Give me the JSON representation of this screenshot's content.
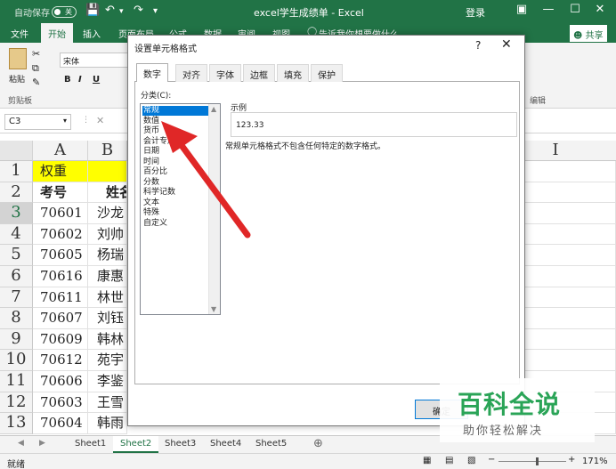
{
  "titlebar": {
    "autosave": "自动保存",
    "autosave_state": "关",
    "doc_title": "excel学生成绩单 - Excel",
    "login": "登录"
  },
  "ribbon_tabs": [
    "文件",
    "开始",
    "插入",
    "页面布局",
    "公式",
    "数据",
    "审阅",
    "视图"
  ],
  "tell_me": "告诉我你想要做什么",
  "share_label": "共享",
  "ribbon": {
    "paste_label": "粘贴",
    "clipboard_label": "剪贴板",
    "font_name": "宋体",
    "bold": "B",
    "italic": "I",
    "underline": "U",
    "edit_label": "编辑"
  },
  "formula": {
    "name_box": "C3",
    "cancel": "✕"
  },
  "sheet": {
    "columns": [
      "A",
      "B",
      "I"
    ],
    "rows": [
      "1",
      "2",
      "3",
      "4",
      "5",
      "6",
      "7",
      "8",
      "9",
      "10",
      "11",
      "12",
      "13"
    ],
    "selected_row": "3",
    "cells": [
      {
        "a": "权重",
        "b": ""
      },
      {
        "a": "考号",
        "b": "姓名"
      },
      {
        "a": "70601",
        "b": "沙龙"
      },
      {
        "a": "70602",
        "b": "刘帅"
      },
      {
        "a": "70605",
        "b": "杨瑞"
      },
      {
        "a": "70616",
        "b": "康惠"
      },
      {
        "a": "70611",
        "b": "林世"
      },
      {
        "a": "70607",
        "b": "刘钰"
      },
      {
        "a": "70609",
        "b": "韩林"
      },
      {
        "a": "70612",
        "b": "苑宇"
      },
      {
        "a": "70606",
        "b": "李鉴"
      },
      {
        "a": "70603",
        "b": "王雪"
      },
      {
        "a": "70604",
        "b": "韩雨"
      }
    ]
  },
  "sheet_tabs": [
    "Sheet1",
    "Sheet2",
    "Sheet3",
    "Sheet4",
    "Sheet5"
  ],
  "active_sheet": "Sheet2",
  "add_sheet": "⊕",
  "status": {
    "ready": "就绪",
    "zoom": "171%",
    "minus": "−",
    "plus": "+"
  },
  "dialog": {
    "title": "设置单元格格式",
    "help": "?",
    "close": "✕",
    "tabs": [
      "数字",
      "对齐",
      "字体",
      "边框",
      "填充",
      "保护"
    ],
    "active_tab": "数字",
    "category_label": "分类(C):",
    "categories": [
      "常规",
      "数值",
      "货币",
      "会计专用",
      "日期",
      "时间",
      "百分比",
      "分数",
      "科学记数",
      "文本",
      "特殊",
      "自定义"
    ],
    "selected_category": "常规",
    "sample_label": "示例",
    "sample_value": "123.33",
    "description": "常规单元格格式不包含任何特定的数字格式。",
    "ok_label": "确定"
  },
  "colors": {
    "excel_green": "#217346",
    "selection_blue": "#0078d7",
    "arrow_red": "#e02727",
    "watermark_green": "#2aa457"
  },
  "watermark": {
    "main": "百科全说",
    "sub": "助你轻松解决"
  }
}
